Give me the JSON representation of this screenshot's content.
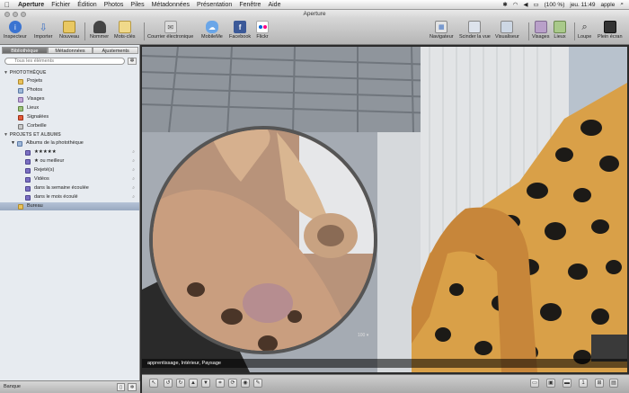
{
  "menubar": {
    "app": "Aperture",
    "items": [
      "Fichier",
      "Édition",
      "Photos",
      "Piles",
      "Métadonnées",
      "Présentation",
      "Fenêtre",
      "Aide"
    ],
    "battery": "(100 %)",
    "clock": "jeu. 11:49",
    "user": "apple"
  },
  "window": {
    "title": "Aperture"
  },
  "toolbar": {
    "inspecteur": "Inspecteur",
    "importer": "Importer",
    "nouveau": "Nouveau",
    "nommer": "Nommer",
    "mots_cles": "Mots-clés",
    "courrier": "Courrier électronique",
    "mobileme": "MobileMe",
    "facebook": "Facebook",
    "flickr": "Flickr",
    "navigateur": "Navigateur",
    "scinder": "Scinder la vue",
    "visualiseur": "Visualiseur",
    "visages": "Visages",
    "lieux": "Lieux",
    "loupe": "Loupe",
    "plein_ecran": "Plein écran"
  },
  "sidebar": {
    "tabs": [
      "Bibliothèque",
      "Métadonnées",
      "Ajustements"
    ],
    "search_placeholder": "Tous les éléments",
    "section_phototheque": "PHOTOTHÈQUE",
    "phototheque_items": [
      "Projets",
      "Photos",
      "Visages",
      "Lieux",
      "Signalées",
      "Corbeille"
    ],
    "section_projets": "PROJETS ET ALBUMS",
    "albums_group": "Albums de la photothèque",
    "albums": [
      "★★★★★",
      "★ ou meilleur",
      "Rejeté(s)",
      "Vidéos",
      "dans la semaine écoulée",
      "dans le mois écoulé"
    ],
    "bureau": "Bureau",
    "bottom_label": "Banque"
  },
  "viewer": {
    "caption": "apprentissage, Intérieur, Paysage",
    "loupe_zoom": "100 ▾"
  },
  "colors": {
    "accent": "#4a78c8",
    "folder": "#e8c15a",
    "album": "#7b6fc2"
  }
}
